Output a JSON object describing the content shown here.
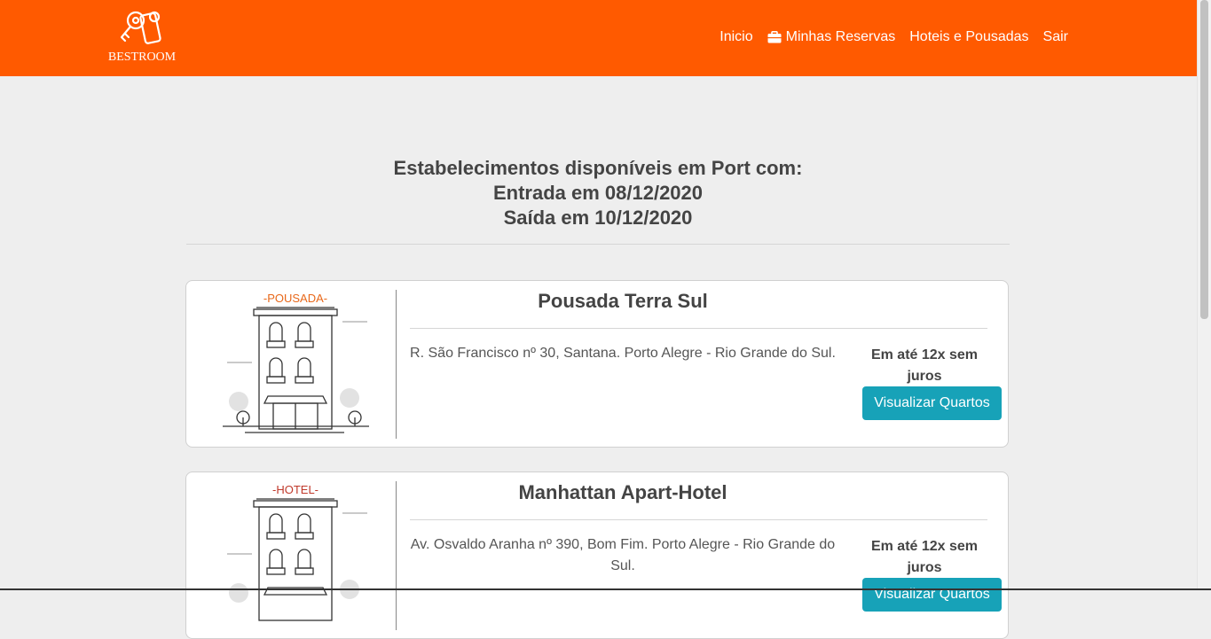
{
  "header": {
    "brand": "BESTROOM",
    "nav": [
      {
        "label": "Inicio",
        "icon": ""
      },
      {
        "label": "Minhas Reservas",
        "icon": "briefcase-icon"
      },
      {
        "label": "Hoteis e Pousadas",
        "icon": ""
      },
      {
        "label": "Sair",
        "icon": ""
      }
    ]
  },
  "main": {
    "heading_line1": "Estabelecimentos disponíveis em Port com:",
    "heading_line2": "Entrada em 08/12/2020",
    "heading_line3": "Saída em 10/12/2020"
  },
  "cards": [
    {
      "type_label": "-POUSADA-",
      "type_color": "#e8681a",
      "title": "Pousada Terra Sul",
      "address": "R. São Francisco nº 30, Santana. Porto Alegre - Rio Grande do Sul.",
      "price_text": "Em até 12x sem juros",
      "button_label": "Visualizar Quartos"
    },
    {
      "type_label": "-HOTEL-",
      "type_color": "#c0392b",
      "title": "Manhattan Apart-Hotel",
      "address": "Av. Osvaldo Aranha nº 390, Bom Fim. Porto Alegre - Rio Grande do Sul.",
      "price_text": "Em até 12x sem juros",
      "button_label": "Visualizar Quartos"
    }
  ],
  "colors": {
    "header_bg": "#ff5a00",
    "button_bg": "#17a2b8",
    "page_bg": "#eeeeee"
  }
}
